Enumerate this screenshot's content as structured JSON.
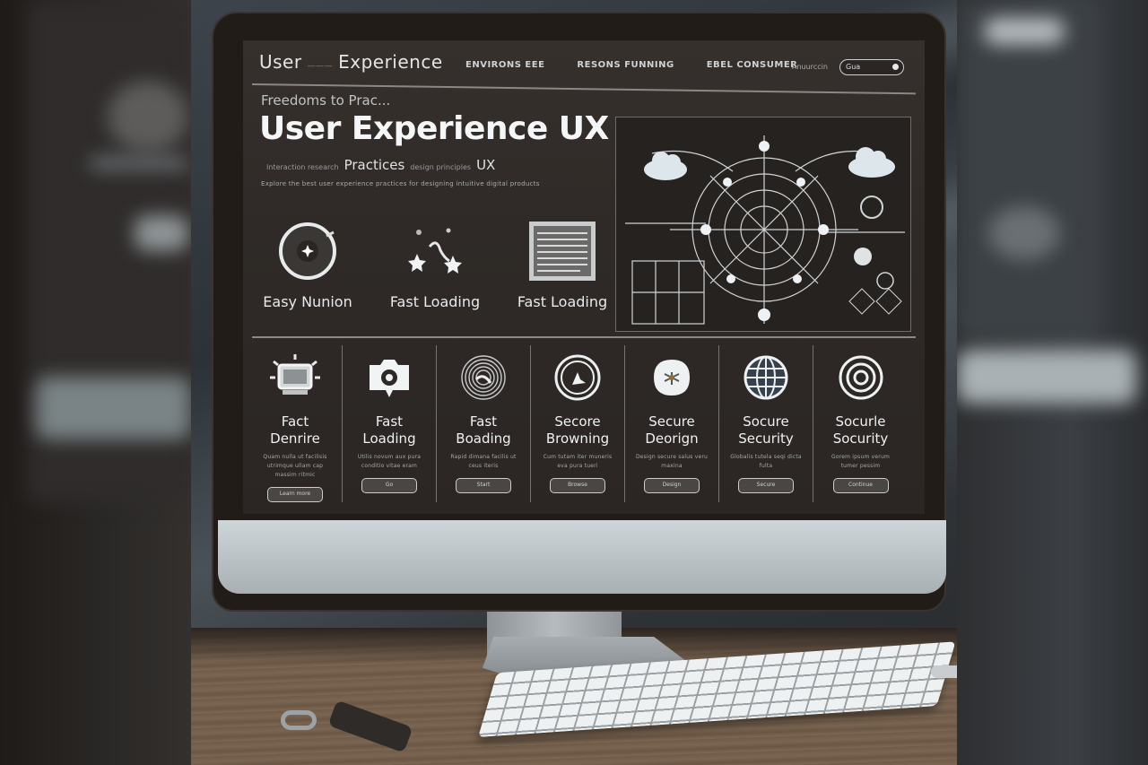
{
  "scene": {
    "description": "Photo of a desktop monitor displaying a UX website",
    "colors": {
      "screen_bg": "#2f2a27",
      "text": "#eef1f2",
      "chin": "#c3cacd",
      "desk": "#74604c"
    }
  },
  "header": {
    "logo_main": "User",
    "logo_filler": "———",
    "logo_second": "Experience",
    "nav": [
      "ENVIRONS EEE",
      "RESONS FUNNING",
      "EBEL CONSUMER"
    ],
    "search_label": "Anuurccin",
    "search_value": "Gua"
  },
  "hero": {
    "kicker": "Freedoms to Prac...",
    "title": "User Experience UX",
    "subtitle_prefix": "Interaction research",
    "subtitle_main": "Practices",
    "subtitle_mid": "design principles",
    "subtitle_end": "UX",
    "description": "Explore the best user experience practices for designing intuitive digital products"
  },
  "features": [
    {
      "icon": "dial-icon",
      "label": "Easy Nunion"
    },
    {
      "icon": "sparkle-stars-icon",
      "label": "Fast Loading"
    },
    {
      "icon": "document-icon",
      "label": "Fast Loading"
    }
  ],
  "cards": [
    {
      "icon": "monitor-icon",
      "title_line1": "Fact",
      "title_line2": "Denrire",
      "desc": "Quam nulla ut facilisis utrimque ullam cap massim ritmic",
      "button": "Learn more"
    },
    {
      "icon": "camera-icon",
      "title_line1": "Fast",
      "title_line2": "Loading",
      "desc": "Utilis novum aux pura conditio vitae eram",
      "button": "Go"
    },
    {
      "icon": "fingerprint-icon",
      "title_line1": "Fast",
      "title_line2": "Boading",
      "desc": "Rapid dimana facilis ut ceus iteris",
      "button": "Start"
    },
    {
      "icon": "target-arrow-icon",
      "title_line1": "Secore",
      "title_line2": "Browning",
      "desc": "Cum tutam iter muneris eva pura tueri",
      "button": "Browse"
    },
    {
      "icon": "drone-icon",
      "title_line1": "Secure",
      "title_line2": "Deorign",
      "desc": "Design secure salus veru maxina",
      "button": "Design"
    },
    {
      "icon": "globe-icon",
      "title_line1": "Socure",
      "title_line2": "Security",
      "desc": "Globalis tutela seqi dicta fulta",
      "button": "Secure"
    },
    {
      "icon": "bullseye-icon",
      "title_line1": "Socurle",
      "title_line2": "Socurity",
      "desc": "Gorem ipsum verum tumer pessim",
      "button": "Continue"
    }
  ]
}
